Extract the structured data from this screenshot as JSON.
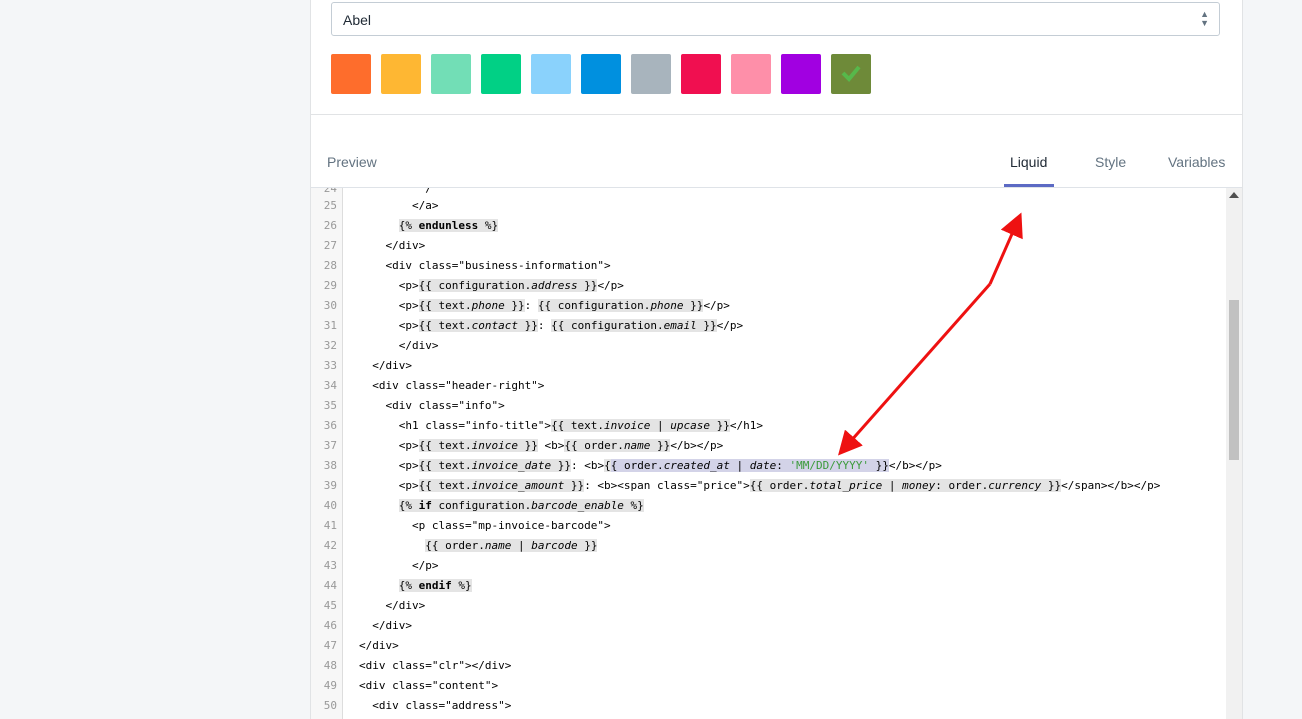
{
  "font_select": {
    "value": "Abel"
  },
  "swatches": [
    {
      "color": "#fe6d2c"
    },
    {
      "color": "#feb733"
    },
    {
      "color": "#72deb6"
    },
    {
      "color": "#01d085"
    },
    {
      "color": "#8ad2fc"
    },
    {
      "color": "#0090df"
    },
    {
      "color": "#a8b4bd"
    },
    {
      "color": "#f00f50"
    },
    {
      "color": "#fe8fa9"
    },
    {
      "color": "#a100e1"
    },
    {
      "color": "#6e8a39",
      "selected": true
    }
  ],
  "tabs": {
    "preview": "Preview",
    "liquid": "Liquid",
    "style": "Style",
    "variables": "Variables",
    "active": "liquid"
  },
  "annotation_color": "#ee1111",
  "code_lines": [
    {
      "n": "25",
      "html": "          &lt;/a&gt;"
    },
    {
      "n": "26",
      "html": "        <span class=\"hl\">{% <span class=\"kw\">endunless</span> %}</span>"
    },
    {
      "n": "27",
      "html": "      &lt;/div&gt;"
    },
    {
      "n": "28",
      "html": "      &lt;div class=\"business-information\"&gt;"
    },
    {
      "n": "29",
      "html": "        &lt;p&gt;<span class=\"hl\">{{ configuration.<span class=\"it\">address</span> }}</span>&lt;/p&gt;"
    },
    {
      "n": "30",
      "html": "        &lt;p&gt;<span class=\"hl\">{{ text.<span class=\"it\">phone</span> }}</span>: <span class=\"hl\">{{ configuration.<span class=\"it\">phone</span> }}</span>&lt;/p&gt;"
    },
    {
      "n": "31",
      "html": "        &lt;p&gt;<span class=\"hl\">{{ text.<span class=\"it\">contact</span> }}</span>: <span class=\"hl\">{{ configuration.<span class=\"it\">email</span> }}</span>&lt;/p&gt;"
    },
    {
      "n": "32",
      "html": "        &lt;/div&gt;"
    },
    {
      "n": "33",
      "html": "    &lt;/div&gt;"
    },
    {
      "n": "34",
      "html": "    &lt;div class=\"header-right\"&gt;"
    },
    {
      "n": "35",
      "html": "      &lt;div class=\"info\"&gt;"
    },
    {
      "n": "36",
      "html": "        &lt;h1 class=\"info-title\"&gt;<span class=\"hl\">{{ text.<span class=\"it\">invoice</span> | <span class=\"it\">upcase</span> }}</span>&lt;/h1&gt;"
    },
    {
      "n": "37",
      "html": "        &lt;p&gt;<span class=\"hl\">{{ text.<span class=\"it\">invoice</span> }}</span> &lt;b&gt;<span class=\"hl\">{{ order.<span class=\"it\">name</span> }}</span>&lt;/b&gt;&lt;/p&gt;"
    },
    {
      "n": "38",
      "html": "        &lt;p&gt;<span class=\"hl\">{{ text.<span class=\"it\">invoice_date</span> }}</span>: &lt;b&gt;<span class=\"hl\">{</span><span class=\"hlsel\">{ order.<span class=\"it\">created_at</span> | <span class=\"it\">date</span>: <span class=\"str\">'MM/DD/YYYY'</span> }}</span>&lt;/b&gt;&lt;/p&gt;"
    },
    {
      "n": "39",
      "html": "        &lt;p&gt;<span class=\"hl\">{{ text.<span class=\"it\">invoice_amount</span> }}</span>: &lt;b&gt;&lt;span class=\"price\"&gt;<span class=\"hl\">{{ order.<span class=\"it\">total_price</span> | <span class=\"it\">money</span>: order.<span class=\"it\">currency</span> }}</span>&lt;/span&gt;&lt;/b&gt;&lt;/p&gt;"
    },
    {
      "n": "40",
      "html": "        <span class=\"hl\">{% <span class=\"kw\">if</span> configuration.<span class=\"it\">barcode_enable</span> %}</span>"
    },
    {
      "n": "41",
      "html": "          &lt;p class=\"mp-invoice-barcode\"&gt;"
    },
    {
      "n": "42",
      "html": "            <span class=\"hl\">{{ order.<span class=\"it\">name</span> | <span class=\"it\">barcode</span> }}</span>"
    },
    {
      "n": "43",
      "html": "          &lt;/p&gt;"
    },
    {
      "n": "44",
      "html": "        <span class=\"hl\">{% <span class=\"kw\">endif</span> %}</span>"
    },
    {
      "n": "45",
      "html": "      &lt;/div&gt;"
    },
    {
      "n": "46",
      "html": "    &lt;/div&gt;"
    },
    {
      "n": "47",
      "html": "  &lt;/div&gt;"
    },
    {
      "n": "48",
      "html": "  &lt;div class=\"clr\"&gt;&lt;/div&gt;"
    },
    {
      "n": "49",
      "html": "  &lt;div class=\"content\"&gt;"
    },
    {
      "n": "50",
      "html": "    &lt;div class=\"address\"&gt;"
    }
  ]
}
